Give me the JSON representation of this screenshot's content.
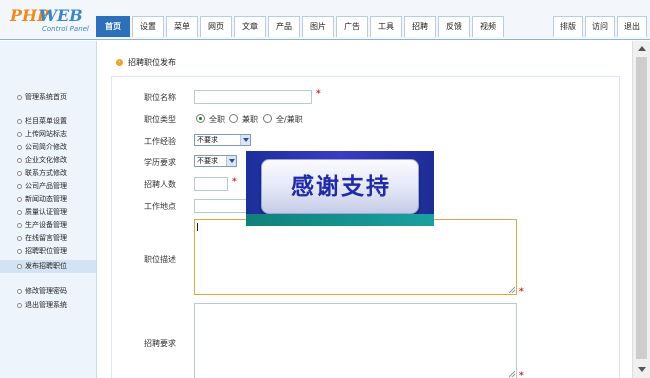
{
  "logo": {
    "part1": "PHP",
    "part2": "WEB",
    "subtitle": "Control Panel"
  },
  "nav": {
    "tabs": [
      "首页",
      "设置",
      "菜单",
      "网页",
      "文章",
      "产品",
      "图片",
      "广告",
      "工具",
      "招聘",
      "反馈",
      "视频"
    ],
    "active": "首页",
    "right": [
      "排版",
      "访问",
      "退出"
    ]
  },
  "sidebar": {
    "items": [
      "管理系统首页",
      "栏目菜单设置",
      "上传网站标志",
      "公司简介修改",
      "企业文化修改",
      "联系方式修改",
      "公司产品管理",
      "新闻动态管理",
      "质量认证管理",
      "生产设备管理",
      "在线留言管理",
      "招聘职位管理",
      "发布招聘职位",
      "修改管理密码",
      "退出管理系统"
    ],
    "active": "发布招聘职位"
  },
  "page": {
    "title": "招聘职位发布"
  },
  "form": {
    "job_name_label": "职位名称",
    "job_type_label": "职位类型",
    "job_type_options": [
      "全职",
      "兼职",
      "全/兼职"
    ],
    "job_type_selected": "全职",
    "experience_label": "工作经验",
    "experience_value": "不要求",
    "education_label": "学历要求",
    "education_value": "不要求",
    "headcount_label": "招聘人数",
    "location_label": "工作地点",
    "description_label": "职位描述",
    "requirements_label": "招聘要求",
    "required_mark": "*"
  },
  "overlay": {
    "text": "感谢支持"
  }
}
